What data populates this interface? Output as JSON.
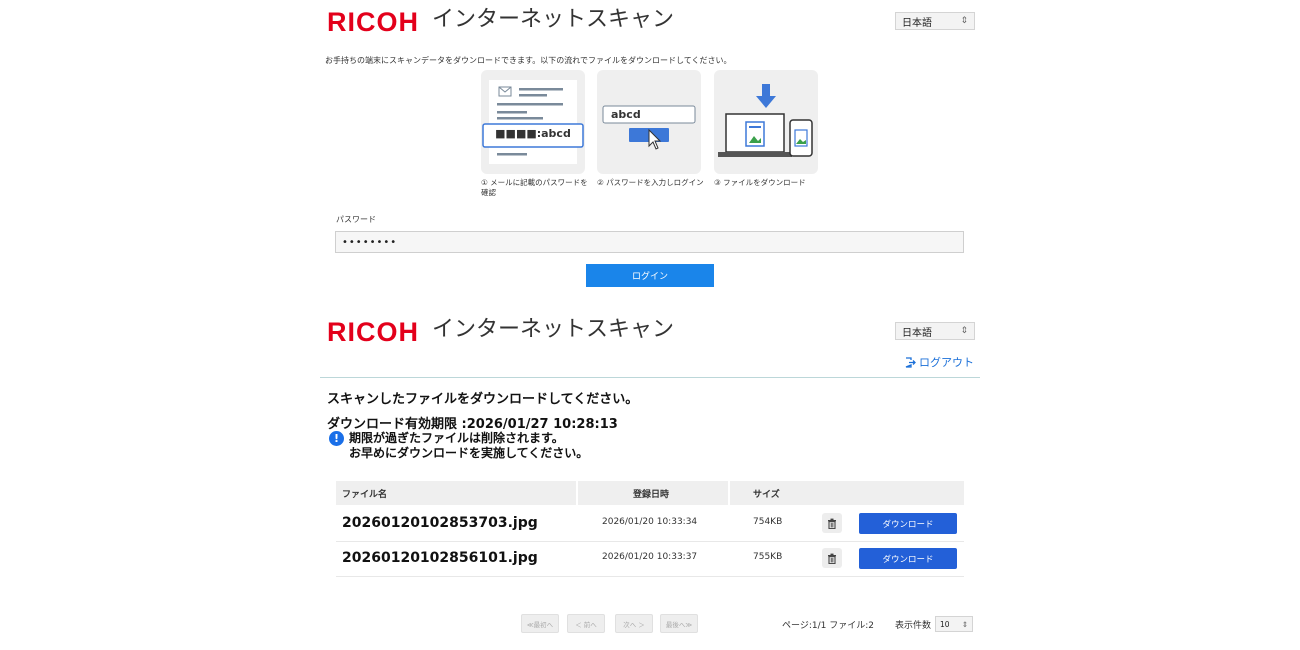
{
  "login_screen": {
    "brand": "RICOH",
    "app_title": "インターネットスキャン",
    "language": "日本語",
    "intro": "お手持ちの端末にスキャンデータをダウンロードできます。以下の流れでファイルをダウンロードしてください。",
    "steps": [
      {
        "caption": "① メールに記載のパスワードを確認",
        "example_text": "■■■■:abcd"
      },
      {
        "caption": "② パスワードを入力しログイン",
        "example_text": "abcd"
      },
      {
        "caption": "③ ファイルをダウンロード"
      }
    ],
    "password_label": "パスワード",
    "password_value": "••••••••",
    "login_button": "ログイン"
  },
  "download_screen": {
    "brand": "RICOH",
    "app_title": "インターネットスキャン",
    "language": "日本語",
    "logout_label": "ログアウト",
    "heading": "スキャンしたファイルをダウンロードしてください。",
    "expiry_label": "ダウンロード有効期限 :2026/01/27 10:28:13",
    "notice_line1": "期限が過ぎたファイルは削除されます。",
    "notice_line2": "お早めにダウンロードを実施してください。",
    "table": {
      "columns": [
        "ファイル名",
        "登録日時",
        "サイズ"
      ],
      "rows": [
        {
          "name": "20260120102853703.jpg",
          "date": "2026/01/20 10:33:34",
          "size": "754KB",
          "action": "ダウンロード"
        },
        {
          "name": "20260120102856101.jpg",
          "date": "2026/01/20 10:33:37",
          "size": "755KB",
          "action": "ダウンロード"
        }
      ]
    },
    "pagination": {
      "first": "≪最初へ",
      "prev": "＜ 前へ",
      "next": "次へ ＞",
      "last": "最後へ≫",
      "info": "ページ:1/1 ファイル:2",
      "per_page_label": "表示件数",
      "per_page_value": "10"
    }
  },
  "colors": {
    "brand_red": "#e3001b",
    "primary_blue": "#1a85ea",
    "download_blue": "#2360d8"
  }
}
